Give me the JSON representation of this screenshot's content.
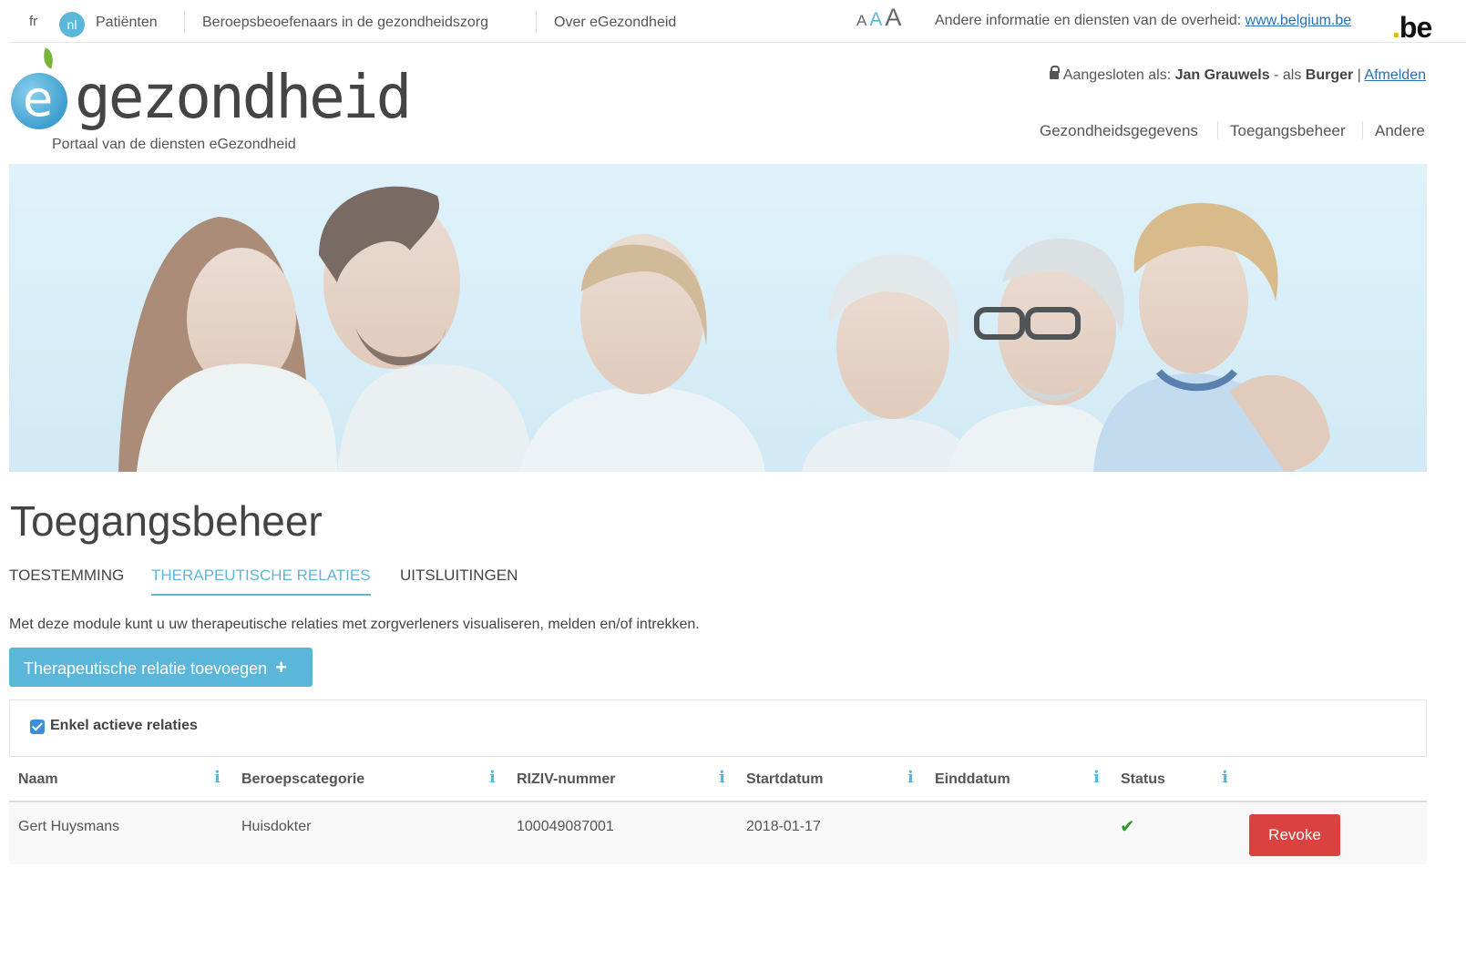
{
  "topbar": {
    "lang_fr": "fr",
    "lang_nl": "nl",
    "links": [
      "Patiënten",
      "Beroepsbeoefenaars in de gezondheidszorg",
      "Over eGezondheid"
    ],
    "font_sizes": [
      "A",
      "A",
      "A"
    ],
    "gov_text": "Andere informatie en diensten van de overheid:",
    "gov_link": "www.belgium.be",
    "be_logo": "be"
  },
  "header": {
    "logo_text": "gezondheid",
    "logo_e": "e",
    "logo_subtitle": "Portaal van de diensten eGezondheid",
    "login_prefix": "Aangesloten als:",
    "user_name": "Jan Grauwels",
    "role_sep": "- als",
    "role": "Burger",
    "logout": "Afmelden",
    "nav": [
      "Gezondheidsgegevens",
      "Toegangsbeheer",
      "Andere"
    ]
  },
  "main": {
    "title": "Toegangsbeheer",
    "tabs": [
      {
        "label": "TOESTEMMING",
        "active": false
      },
      {
        "label": "THERAPEUTISCHE RELATIES",
        "active": true
      },
      {
        "label": "UITSLUITINGEN",
        "active": false
      }
    ],
    "intro": "Met deze module kunt u uw therapeutische relaties met zorgverleners visualiseren, melden en/of intrekken.",
    "add_button": "Therapeutische relatie toevoegen",
    "add_button_icon": "+",
    "filter": {
      "label": "Enkel actieve relaties",
      "checked": true
    }
  },
  "table": {
    "headers": [
      "Naam",
      "Beroepscategorie",
      "RIZIV-nummer",
      "Startdatum",
      "Einddatum",
      "Status"
    ],
    "info_glyph": "i",
    "rows": [
      {
        "naam": "Gert Huysmans",
        "categorie": "Huisdokter",
        "riziv": "100049087001",
        "start": "2018-01-17",
        "eind": "",
        "status": "active",
        "status_glyph": "✔",
        "action": "Revoke"
      }
    ]
  },
  "colors": {
    "accent": "#5bb7d9",
    "danger": "#d9423f",
    "success": "#2c9b2c",
    "link": "#2a6fb5"
  }
}
